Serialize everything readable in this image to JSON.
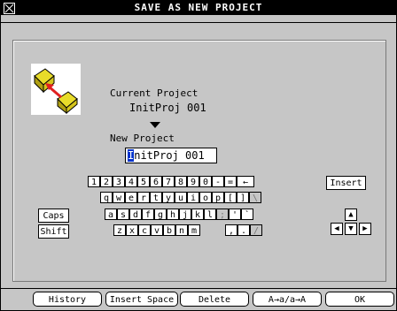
{
  "window": {
    "title": "SAVE AS NEW PROJECT"
  },
  "project": {
    "current_label": "Current Project",
    "current_name": "InitProj 001",
    "new_label": "New Project",
    "new_first_char": "I",
    "new_rest": "nitProj 001"
  },
  "keyboard": {
    "row1": [
      "1",
      "2",
      "3",
      "4",
      "5",
      "6",
      "7",
      "8",
      "9",
      "0",
      "-",
      "=",
      "←"
    ],
    "row2": [
      "q",
      "w",
      "e",
      "r",
      "t",
      "y",
      "u",
      "i",
      "o",
      "p",
      "[",
      "]",
      "\\"
    ],
    "row3": [
      "a",
      "s",
      "d",
      "f",
      "g",
      "h",
      "j",
      "k",
      "l",
      ";",
      "'",
      "`"
    ],
    "row4": [
      "z",
      "x",
      "c",
      "v",
      "b",
      "n",
      "m",
      ",",
      ".",
      "/"
    ],
    "caps": "Caps",
    "shift": "Shift",
    "insert": "Insert"
  },
  "buttons": {
    "history": "History",
    "insert_space": "Insert Space",
    "delete": "Delete",
    "case": "A→a/a→A",
    "ok": "OK"
  },
  "icons": {
    "close": "close-box-icon",
    "save_project": "save-project-icon",
    "down": "triangle-down-icon"
  }
}
